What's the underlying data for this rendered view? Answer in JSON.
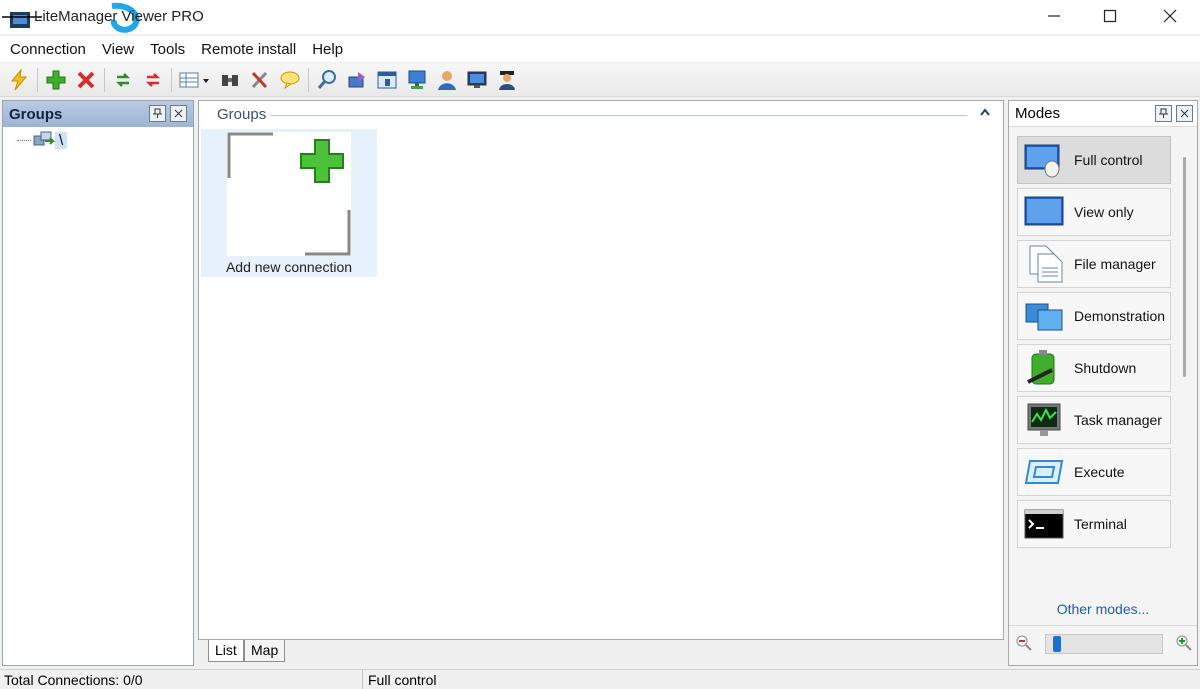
{
  "window": {
    "title": "LiteManager Viewer PRO",
    "minimize_icon": "minimize-icon",
    "maximize_icon": "maximize-icon",
    "close_icon": "close-icon"
  },
  "menu": [
    "Connection",
    "View",
    "Tools",
    "Remote install",
    "Help"
  ],
  "toolbar": {
    "icons": [
      "connect-icon",
      "add-icon",
      "delete-icon",
      "refresh-icon",
      "refresh-all-icon",
      "view-mode-icon",
      "search-icon",
      "settings-icon",
      "chat-icon",
      "find-icon",
      "network-icon",
      "window-icon",
      "server-icon",
      "user-icon",
      "monitor-icon",
      "admin-icon"
    ]
  },
  "left_panel": {
    "title": "Groups",
    "tree_root": "\\"
  },
  "main": {
    "group_header": "Groups",
    "tiles": [
      {
        "label": "Add new connection"
      }
    ],
    "tabs": [
      "List",
      "Map"
    ]
  },
  "modes_panel": {
    "title": "Modes",
    "items": [
      {
        "label": "Full control",
        "selected": true
      },
      {
        "label": "View only"
      },
      {
        "label": "File manager"
      },
      {
        "label": "Demonstration"
      },
      {
        "label": "Shutdown"
      },
      {
        "label": "Task manager"
      },
      {
        "label": "Execute"
      },
      {
        "label": "Terminal"
      }
    ],
    "other_modes": "Other modes...",
    "zoom_level": 0.05
  },
  "status": {
    "total_connections": "Total Connections:  0/0",
    "mode": "Full control"
  },
  "colors": {
    "accent": "#1f6fd1",
    "header": "#9db4d4",
    "delete": "#d32f2f",
    "add": "#3fae2a"
  }
}
